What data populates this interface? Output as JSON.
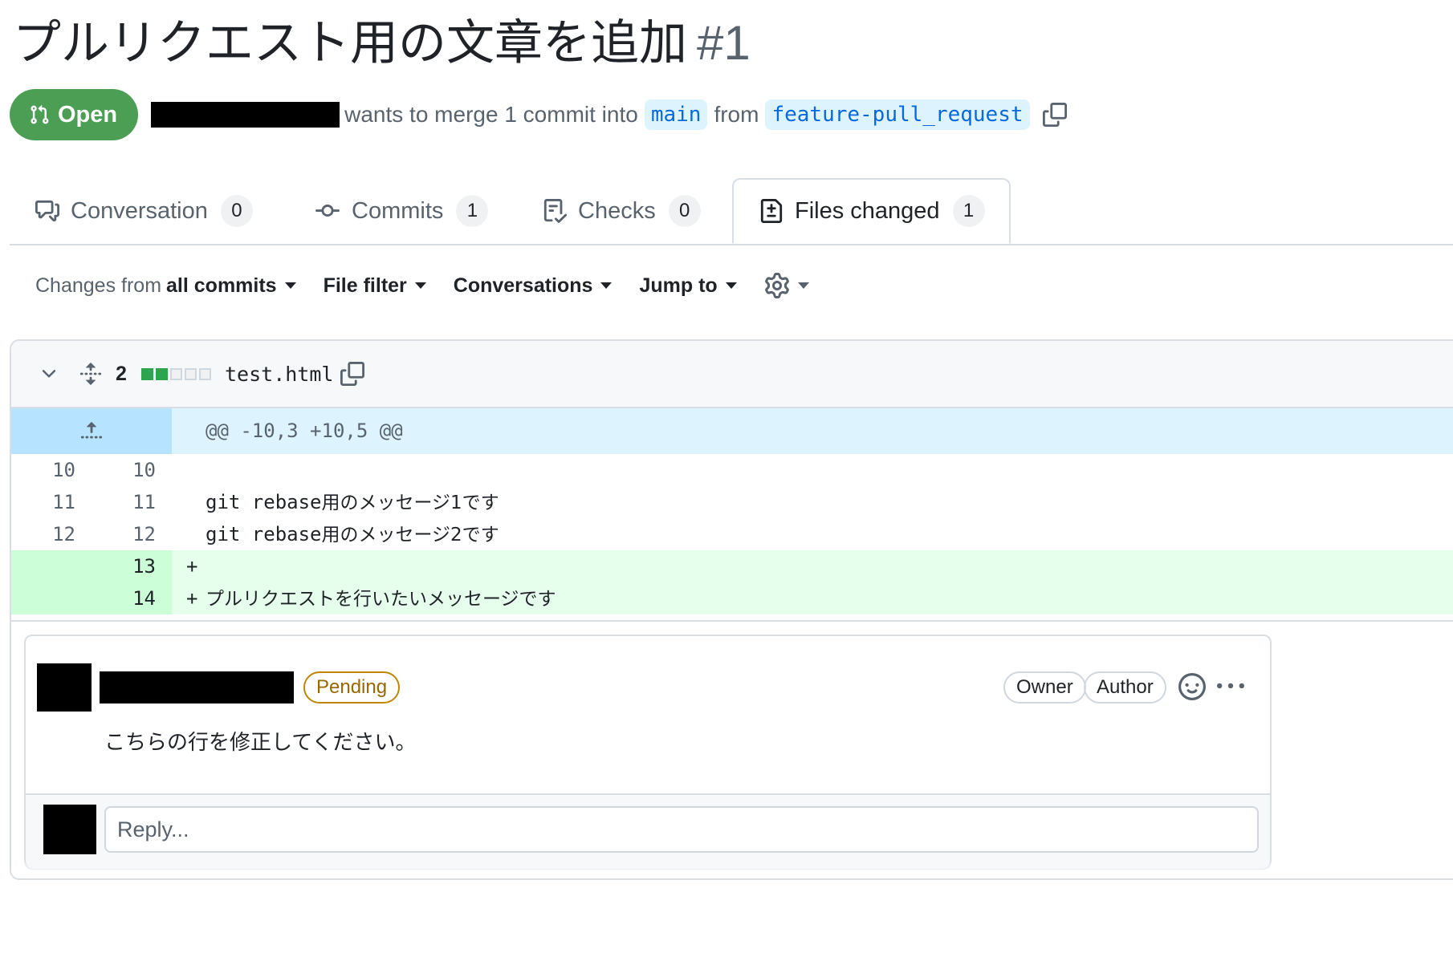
{
  "pr": {
    "title": "プルリクエスト用の文章を追加",
    "number": "#1",
    "state": "Open",
    "merge_text": "wants to merge 1 commit into",
    "from_text": "from",
    "base_branch": "main",
    "head_branch": "feature-pull_request"
  },
  "tabs": [
    {
      "label": "Conversation",
      "count": "0",
      "icon": "comment-discussion-icon"
    },
    {
      "label": "Commits",
      "count": "1",
      "icon": "git-commit-icon"
    },
    {
      "label": "Checks",
      "count": "0",
      "icon": "checklist-icon"
    },
    {
      "label": "Files changed",
      "count": "1",
      "icon": "file-diff-icon",
      "selected": true
    }
  ],
  "toolbar": {
    "changes_prefix": "Changes from",
    "changes_value": "all commits",
    "file_filter": "File filter",
    "conversations": "Conversations",
    "jump_to": "Jump to",
    "settings_icon": "gear-icon"
  },
  "file": {
    "changes_count": "2",
    "diffstat": [
      "add",
      "add",
      "neutral",
      "neutral",
      "neutral"
    ],
    "name": "test.html",
    "hunk_header": "@@ -10,3 +10,5 @@",
    "lines": [
      {
        "type": "context",
        "old": "10",
        "new": "10",
        "text": ""
      },
      {
        "type": "context",
        "old": "11",
        "new": "11",
        "text_code": "git rebase",
        "text_jp": "用のメッセージ1です"
      },
      {
        "type": "context",
        "old": "12",
        "new": "12",
        "text_code": "git rebase",
        "text_jp": "用のメッセージ2です"
      },
      {
        "type": "added",
        "old": "",
        "new": "13",
        "sign": "+",
        "text": ""
      },
      {
        "type": "added",
        "old": "",
        "new": "14",
        "sign": "+",
        "text_jp": "プルリクエストを行いたいメッセージです"
      }
    ]
  },
  "comment": {
    "status": "Pending",
    "labels": [
      "Owner",
      "Author"
    ],
    "body": "こちらの行を修正してください。",
    "reply_placeholder": "Reply..."
  }
}
